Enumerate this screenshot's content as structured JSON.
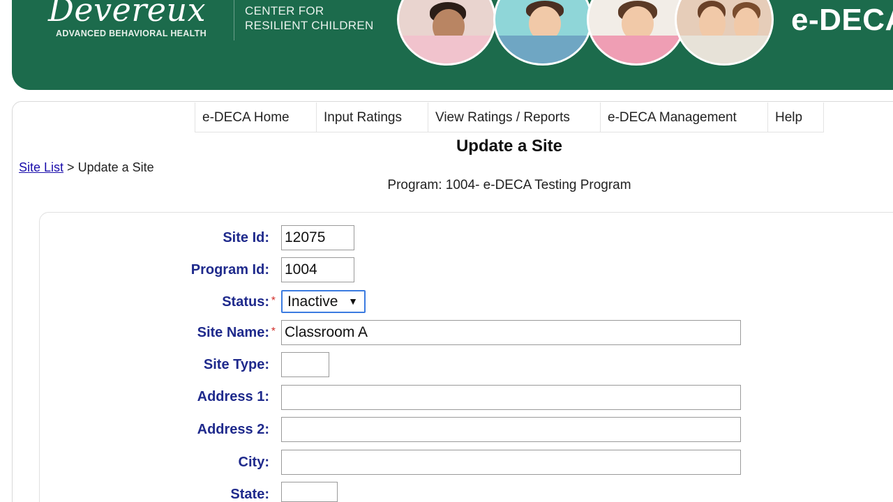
{
  "header": {
    "logo_word": "Devereux",
    "logo_subtitle": "ADVANCED BEHAVIORAL HEALTH",
    "center_line1": "CENTER FOR",
    "center_line2": "RESILIENT CHILDREN",
    "brand": "e-DECA",
    "colors": {
      "banner": "#1c6b4c"
    }
  },
  "nav": {
    "items": [
      {
        "label": "e-DECA Home"
      },
      {
        "label": "Input Ratings"
      },
      {
        "label": "View Ratings / Reports"
      },
      {
        "label": "e-DECA Management"
      },
      {
        "label": "Help"
      }
    ]
  },
  "page": {
    "title": "Update a Site",
    "breadcrumb_link": "Site List",
    "breadcrumb_sep": ">",
    "breadcrumb_current": "Update a Site",
    "program_line": "Program: 1004- e-DECA Testing Program"
  },
  "form": {
    "site_id_label": "Site Id:",
    "site_id_value": "12075",
    "program_id_label": "Program Id:",
    "program_id_value": "1004",
    "status_label": "Status:",
    "status_value": "Inactive",
    "site_name_label": "Site Name:",
    "site_name_value": "Classroom A",
    "site_type_label": "Site Type:",
    "site_type_value": "",
    "address1_label": "Address 1:",
    "address1_value": "",
    "address2_label": "Address 2:",
    "address2_value": "",
    "city_label": "City:",
    "city_value": "",
    "state_label": "State:",
    "state_value": "",
    "required_mark": "*"
  }
}
